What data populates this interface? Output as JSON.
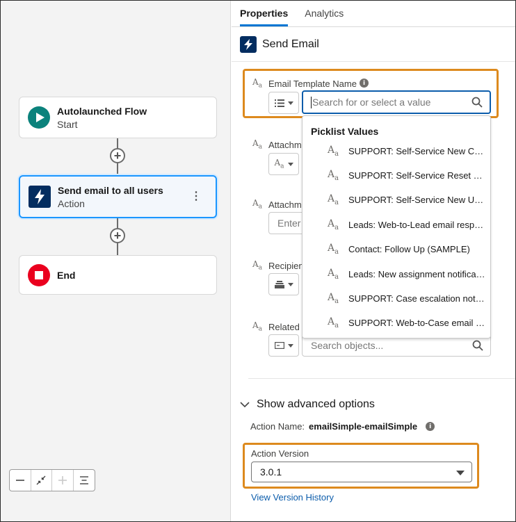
{
  "canvas": {
    "nodes": [
      {
        "title": "Autolaunched Flow",
        "subtitle": "Start",
        "icon": "play-icon",
        "color": "#0b827c"
      },
      {
        "title": "Send email to all users",
        "subtitle": "Action",
        "icon": "lightning-icon",
        "color": "#032d60",
        "selected": true
      },
      {
        "title": "End",
        "subtitle": "",
        "icon": "stop-icon",
        "color": "#ea001e"
      }
    ],
    "add_symbol": "+",
    "kebab_symbol": "⋮"
  },
  "tabs": [
    {
      "label": "Properties",
      "active": true
    },
    {
      "label": "Analytics",
      "active": false
    }
  ],
  "panel": {
    "title": "Send Email",
    "fields": [
      {
        "label": "Email Template Name",
        "placeholder": "Search for or select a value"
      },
      {
        "label": "Attachm"
      },
      {
        "label": "Attachm",
        "placeholder": "Enter"
      },
      {
        "label": "Recipien"
      },
      {
        "label": "Related I",
        "placeholder": "Search objects..."
      }
    ],
    "aa_glyph": "A",
    "aa_sub": "a"
  },
  "dropdown": {
    "heading": "Picklist Values",
    "items": [
      "SUPPORT: Self-Service New Co...",
      "SUPPORT: Self-Service Reset Pa...",
      "SUPPORT: Self-Service New Use...",
      "Leads: Web-to-Lead email respo...",
      "Contact: Follow Up (SAMPLE)",
      "Leads: New assignment notificati...",
      "SUPPORT: Case escalation notifi...",
      "SUPPORT: Web-to-Case email re..."
    ]
  },
  "advanced": {
    "toggle_label": "Show advanced options",
    "action_name_label": "Action Name:",
    "action_name_value": "emailSimple-emailSimple",
    "version_label": "Action Version",
    "version_value": "3.0.1",
    "history_link": "View Version History"
  },
  "colors": {
    "highlight": "#dd8a1e",
    "accent": "#0176d3",
    "link": "#0b5cab"
  }
}
